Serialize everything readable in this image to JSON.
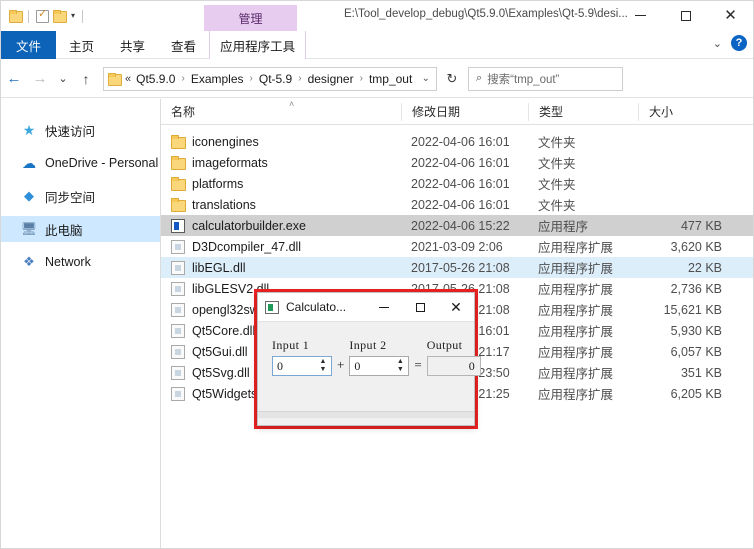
{
  "window": {
    "path_title": "E:\\Tool_develop_debug\\Qt5.9.0\\Examples\\Qt-5.9\\desi...",
    "minimize_label": "",
    "maximize_label": "",
    "close_label": "✕"
  },
  "quick_access": {
    "folder_icon": "folder-icon",
    "properties_icon": "properties-checkbox-icon",
    "new_folder_icon": "new-folder-icon",
    "customize_caret": "▾"
  },
  "ribbon": {
    "contextual_group_label": "管理",
    "tabs": [
      {
        "label": "文件",
        "kind": "file"
      },
      {
        "label": "主页",
        "kind": "normal"
      },
      {
        "label": "共享",
        "kind": "normal"
      },
      {
        "label": "查看",
        "kind": "normal"
      },
      {
        "label": "应用程序工具",
        "kind": "contextual"
      }
    ],
    "collapse_caret": "⌄",
    "help_label": "?"
  },
  "address_bar": {
    "back": "←",
    "forward": "→",
    "recent": "⌄",
    "up": "↑",
    "breadcrumb_lead": "«",
    "crumbs": [
      "Qt5.9.0",
      "Examples",
      "Qt-5.9",
      "designer",
      "tmp_out"
    ],
    "separator": "›",
    "dropdown": "⌄",
    "refresh": "↻",
    "search_icon": "⌕",
    "search_placeholder": "搜索“tmp_out”"
  },
  "nav_pane": {
    "items": [
      {
        "label": "快速访问",
        "icon": "star-icon",
        "glyph": "★",
        "selected": false
      },
      {
        "label": "OneDrive - Personal",
        "icon": "cloud-icon",
        "glyph": "☁",
        "selected": false
      },
      {
        "label": "同步空间",
        "icon": "sync-icon",
        "glyph": "◆",
        "selected": false
      },
      {
        "label": "此电脑",
        "icon": "this-pc-icon",
        "glyph": "🖥",
        "selected": true
      },
      {
        "label": "Network",
        "icon": "network-icon",
        "glyph": "❖",
        "selected": false
      }
    ]
  },
  "file_list": {
    "columns": [
      "名称",
      "修改日期",
      "类型",
      "大小"
    ],
    "sort_indicator": "˄",
    "rows": [
      {
        "name": "iconengines",
        "date": "2022-04-06 16:01",
        "type": "文件夹",
        "size": "",
        "icon": "folder",
        "state": ""
      },
      {
        "name": "imageformats",
        "date": "2022-04-06 16:01",
        "type": "文件夹",
        "size": "",
        "icon": "folder",
        "state": ""
      },
      {
        "name": "platforms",
        "date": "2022-04-06 16:01",
        "type": "文件夹",
        "size": "",
        "icon": "folder",
        "state": ""
      },
      {
        "name": "translations",
        "date": "2022-04-06 16:01",
        "type": "文件夹",
        "size": "",
        "icon": "folder",
        "state": ""
      },
      {
        "name": "calculatorbuilder.exe",
        "date": "2022-04-06 15:22",
        "type": "应用程序",
        "size": "477 KB",
        "icon": "exe",
        "state": "sel-gray"
      },
      {
        "name": "D3Dcompiler_47.dll",
        "date": "2021-03-09 2:06",
        "type": "应用程序扩展",
        "size": "3,620 KB",
        "icon": "dll",
        "state": ""
      },
      {
        "name": "libEGL.dll",
        "date": "2017-05-26 21:08",
        "type": "应用程序扩展",
        "size": "22 KB",
        "icon": "dll",
        "state": "sel-blue"
      },
      {
        "name": "libGLESV2.dll",
        "date": "2017-05-26 21:08",
        "type": "应用程序扩展",
        "size": "2,736 KB",
        "icon": "dll",
        "state": ""
      },
      {
        "name": "opengl32sw.dll",
        "date": "2017-05-26 21:08",
        "type": "应用程序扩展",
        "size": "15,621 KB",
        "icon": "dll",
        "state": ""
      },
      {
        "name": "Qt5Core.dll",
        "date": "2022-04-06 16:01",
        "type": "应用程序扩展",
        "size": "5,930 KB",
        "icon": "dll",
        "state": ""
      },
      {
        "name": "Qt5Gui.dll",
        "date": "2017-05-26 21:17",
        "type": "应用程序扩展",
        "size": "6,057 KB",
        "icon": "dll",
        "state": ""
      },
      {
        "name": "Qt5Svg.dll",
        "date": "2017-05-26 23:50",
        "type": "应用程序扩展",
        "size": "351 KB",
        "icon": "dll",
        "state": ""
      },
      {
        "name": "Qt5Widgets.dll",
        "date": "2017-05-26 21:25",
        "type": "应用程序扩展",
        "size": "6,205 KB",
        "icon": "dll",
        "state": ""
      }
    ]
  },
  "calculator": {
    "title": "Calculato...",
    "app_icon": "calculator-app-icon",
    "minimize_label": "",
    "maximize_label": "",
    "close_label": "✕",
    "input1_label": "Input 1",
    "input1_value": "0",
    "input2_label": "Input 2",
    "input2_value": "0",
    "output_label": "Output",
    "output_value": "0",
    "operator_plus": "+",
    "operator_equals": "=",
    "spinner_up": "▲",
    "spinner_down": "▼"
  },
  "annotation": {
    "highlight_color": "#ee2222"
  }
}
